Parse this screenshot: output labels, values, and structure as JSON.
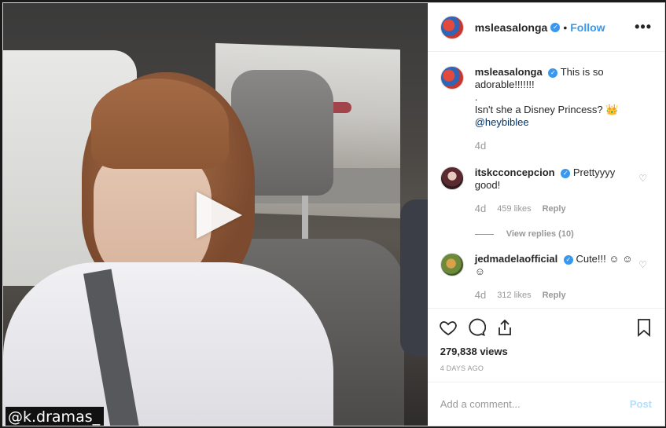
{
  "video": {
    "watermark": "@k.dramas_",
    "play_icon": "play-icon"
  },
  "header": {
    "username": "msleasalonga",
    "dot": "•",
    "follow_label": "Follow",
    "more_icon": "more-options-icon"
  },
  "caption": {
    "username": "msleasalonga",
    "line1": "This is so adorable!!!!!!!",
    "line2": ".",
    "line3": "Isn't she a Disney Princess? 👑",
    "mention": "@heybiblee",
    "time": "4d"
  },
  "comments": [
    {
      "username": "itskcconcepcion",
      "text": "Prettyyyy good!",
      "time": "4d",
      "likes": "459 likes",
      "reply": "Reply",
      "view_replies": "View replies (10)"
    },
    {
      "username": "jedmadelaofficial",
      "text": "Cute!!! ☺ ☺ ☺",
      "time": "4d",
      "likes": "312 likes",
      "reply": "Reply"
    }
  ],
  "stats": {
    "views": "279,838 views",
    "ago": "4 DAYS AGO"
  },
  "composer": {
    "placeholder": "Add a comment...",
    "post_label": "Post"
  },
  "colors": {
    "accent": "#3897f0",
    "post_disabled": "#b2dffc"
  }
}
